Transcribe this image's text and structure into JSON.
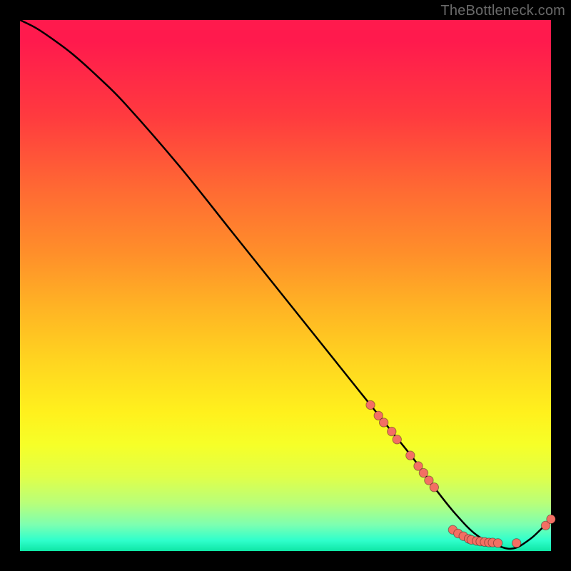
{
  "watermark": "TheBottleneck.com",
  "colors": {
    "marker_fill": "#f36f63",
    "curve_stroke": "#000000"
  },
  "chart_data": {
    "type": "line",
    "title": "",
    "xlabel": "",
    "ylabel": "",
    "xlim": [
      0,
      100
    ],
    "ylim": [
      0,
      100
    ],
    "grid": false,
    "legend": false,
    "series": [
      {
        "name": "curve",
        "x": [
          0,
          3,
          6,
          10,
          15,
          20,
          30,
          40,
          50,
          60,
          66,
          70,
          74,
          78,
          82,
          86,
          90,
          93,
          96,
          98,
          100
        ],
        "y": [
          100,
          98.5,
          96.5,
          93.5,
          89,
          84,
          72.5,
          60,
          47.5,
          35,
          27.5,
          22.5,
          17.5,
          12,
          7,
          3,
          1,
          0.5,
          2.2,
          4,
          6
        ]
      }
    ],
    "markers": [
      {
        "x": 66.0,
        "y": 27.5
      },
      {
        "x": 67.5,
        "y": 25.5
      },
      {
        "x": 68.5,
        "y": 24.2
      },
      {
        "x": 70.0,
        "y": 22.5
      },
      {
        "x": 71.0,
        "y": 21.0
      },
      {
        "x": 73.5,
        "y": 18.0
      },
      {
        "x": 75.0,
        "y": 16.0
      },
      {
        "x": 76.0,
        "y": 14.7
      },
      {
        "x": 77.0,
        "y": 13.3
      },
      {
        "x": 78.0,
        "y": 12.0
      },
      {
        "x": 81.5,
        "y": 4.0
      },
      {
        "x": 82.5,
        "y": 3.3
      },
      {
        "x": 83.5,
        "y": 2.8
      },
      {
        "x": 84.5,
        "y": 2.3
      },
      {
        "x": 85.0,
        "y": 2.1
      },
      {
        "x": 86.0,
        "y": 1.9
      },
      {
        "x": 86.7,
        "y": 1.8
      },
      {
        "x": 87.5,
        "y": 1.7
      },
      {
        "x": 88.3,
        "y": 1.6
      },
      {
        "x": 89.0,
        "y": 1.6
      },
      {
        "x": 90.0,
        "y": 1.5
      },
      {
        "x": 93.5,
        "y": 1.5
      },
      {
        "x": 99.0,
        "y": 4.8
      },
      {
        "x": 100.0,
        "y": 6.0
      }
    ]
  }
}
